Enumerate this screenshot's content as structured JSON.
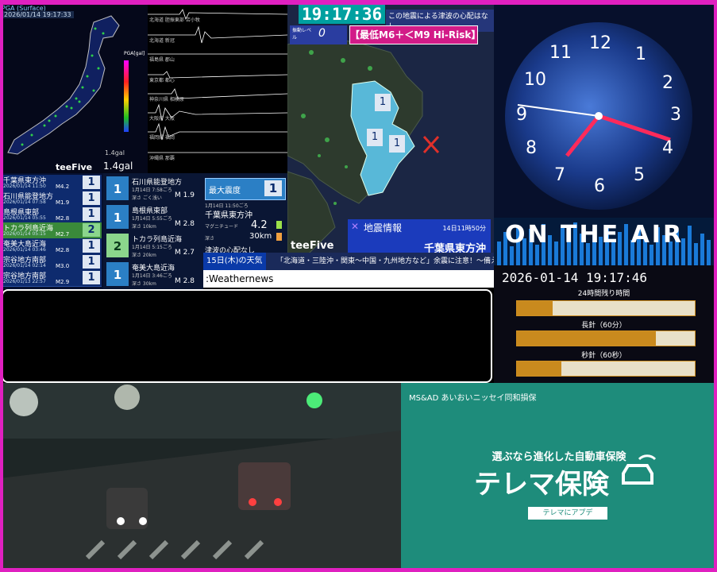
{
  "pga": {
    "title": "PGA (Surface)",
    "timestamp": "2026/01/14 19:17:33",
    "scale_label": "PGA[gal]",
    "value_small": "1.4gal",
    "value": "1.4gal",
    "brand": "teeFive"
  },
  "waveform": {
    "stations": [
      "北海道 胆振東部 苫小牧",
      "北海道 新冠",
      "福島県 郡山",
      "東京都 都心",
      "神奈川県 相模原",
      "大阪府 大阪",
      "福岡県 福岡",
      "沖縄県 那覇"
    ]
  },
  "eq_list": {
    "items": [
      {
        "name": "千葉県東方沖",
        "date": "2026/01/14 11:50",
        "mag": "M4.2",
        "intensity": "1"
      },
      {
        "name": "石川県能登地方",
        "date": "2026/01/14 07:58",
        "mag": "M1.9",
        "intensity": "1"
      },
      {
        "name": "島根県東部",
        "date": "2026/01/14 05:55",
        "mag": "M2.8",
        "intensity": "1"
      },
      {
        "name": "トカラ列島近海",
        "date": "2026/01/14 05:15",
        "mag": "M2.7",
        "intensity": "2"
      },
      {
        "name": "奄美大島近海",
        "date": "2026/01/14 03:46",
        "mag": "M2.8",
        "intensity": "1"
      },
      {
        "name": "宗谷地方南部",
        "date": "2026/01/14 02:14",
        "mag": "M3.0",
        "intensity": "1"
      },
      {
        "name": "宗谷地方南部",
        "date": "2026/01/13 22:57",
        "mag": "M2.9",
        "intensity": "1"
      }
    ]
  },
  "eq_detail": {
    "items": [
      {
        "place": "石川県能登地方",
        "time": "1月14日 7:58ごろ",
        "depth": "深さ ごく浅い",
        "mag": "M 1.9",
        "intensity": "1"
      },
      {
        "place": "島根県東部",
        "time": "1月14日 5:55ごろ",
        "depth": "深さ 10km",
        "mag": "M 2.8",
        "intensity": "1"
      },
      {
        "place": "トカラ列島近海",
        "time": "1月14日 5:15ごろ",
        "depth": "深さ 20km",
        "mag": "M 2.7",
        "intensity": "2"
      },
      {
        "place": "奄美大島近海",
        "time": "1月14日 3:46ごろ",
        "depth": "深さ 30km",
        "mag": "M 2.8",
        "intensity": "1"
      }
    ]
  },
  "max_panel": {
    "label": "最大震度",
    "value": "1",
    "time": "1月14日 11:50ごろ",
    "place": "千葉県東方沖",
    "mag_label": "マグニチュード",
    "mag": "4.2",
    "depth_label": "深さ",
    "depth": "30km",
    "tsunami": "津波の心配なし"
  },
  "center": {
    "clock": "19:17:36",
    "top_note": "この地震による津波の心配はなし",
    "level_label": "振動レベル",
    "level": "0",
    "risk": "【最低M6＋＜M9 Hi-Risk】",
    "brand": "teeFive",
    "info_title": "地震情報",
    "info_time": "14日11時50分",
    "info_place": "千葉県東方沖",
    "map_intensities": [
      "1",
      "1",
      "1"
    ]
  },
  "weather": {
    "day": "15日(木)の天気",
    "ticker": "「北海道・三陸沖・関東〜中国・九州地方など」余震に注意！〜備えを〜",
    "source": ":Weathernews"
  },
  "clock_art": {
    "numbers": [
      "12",
      "1",
      "2",
      "3",
      "4",
      "5",
      "6",
      "7",
      "8",
      "9",
      "10",
      "11"
    ]
  },
  "on_air": {
    "text": "ON THE AIR",
    "datetime": "2026-01-14 19:17:46",
    "rows": [
      {
        "label": "24時間残り時間",
        "progress": 0.2
      },
      {
        "label": "長針（60分）",
        "progress": 0.78
      },
      {
        "label": "秒針（60秒）",
        "progress": 0.25
      }
    ]
  },
  "ad": {
    "brand": "MS&AD あいおいニッセイ同和損保",
    "tagline": "選ぶなら進化した自動車保険",
    "product": "テレマ保険",
    "search": "テレマにアプデ"
  },
  "colors": {
    "frame": "#e020c0",
    "risk": "#d21b88",
    "ad_bg": "#1e8c7b"
  }
}
